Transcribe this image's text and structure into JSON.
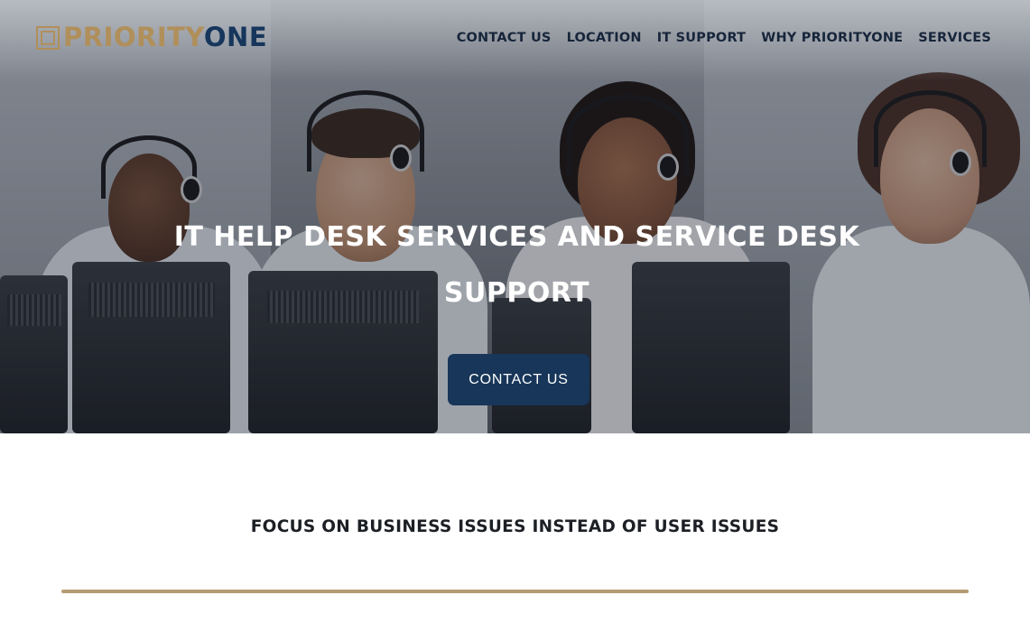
{
  "brand": {
    "logo_part1": "PRIORITY",
    "logo_part2": "ONE",
    "colors": {
      "gold": "#b08f5a",
      "navy": "#16365c"
    }
  },
  "nav": {
    "items": [
      {
        "label": "CONTACT US"
      },
      {
        "label": "LOCATION"
      },
      {
        "label": "IT SUPPORT"
      },
      {
        "label": "WHY PRIORITYONE"
      },
      {
        "label": "SERVICES"
      }
    ]
  },
  "hero": {
    "title_line1": "IT HELP DESK SERVICES AND SERVICE DESK",
    "title_line2": "SUPPORT",
    "cta_label": "CONTACT US",
    "cta_color": "#173659"
  },
  "section": {
    "title": "FOCUS ON BUSINESS ISSUES INSTEAD OF USER ISSUES",
    "divider_color": "#b59c72"
  }
}
